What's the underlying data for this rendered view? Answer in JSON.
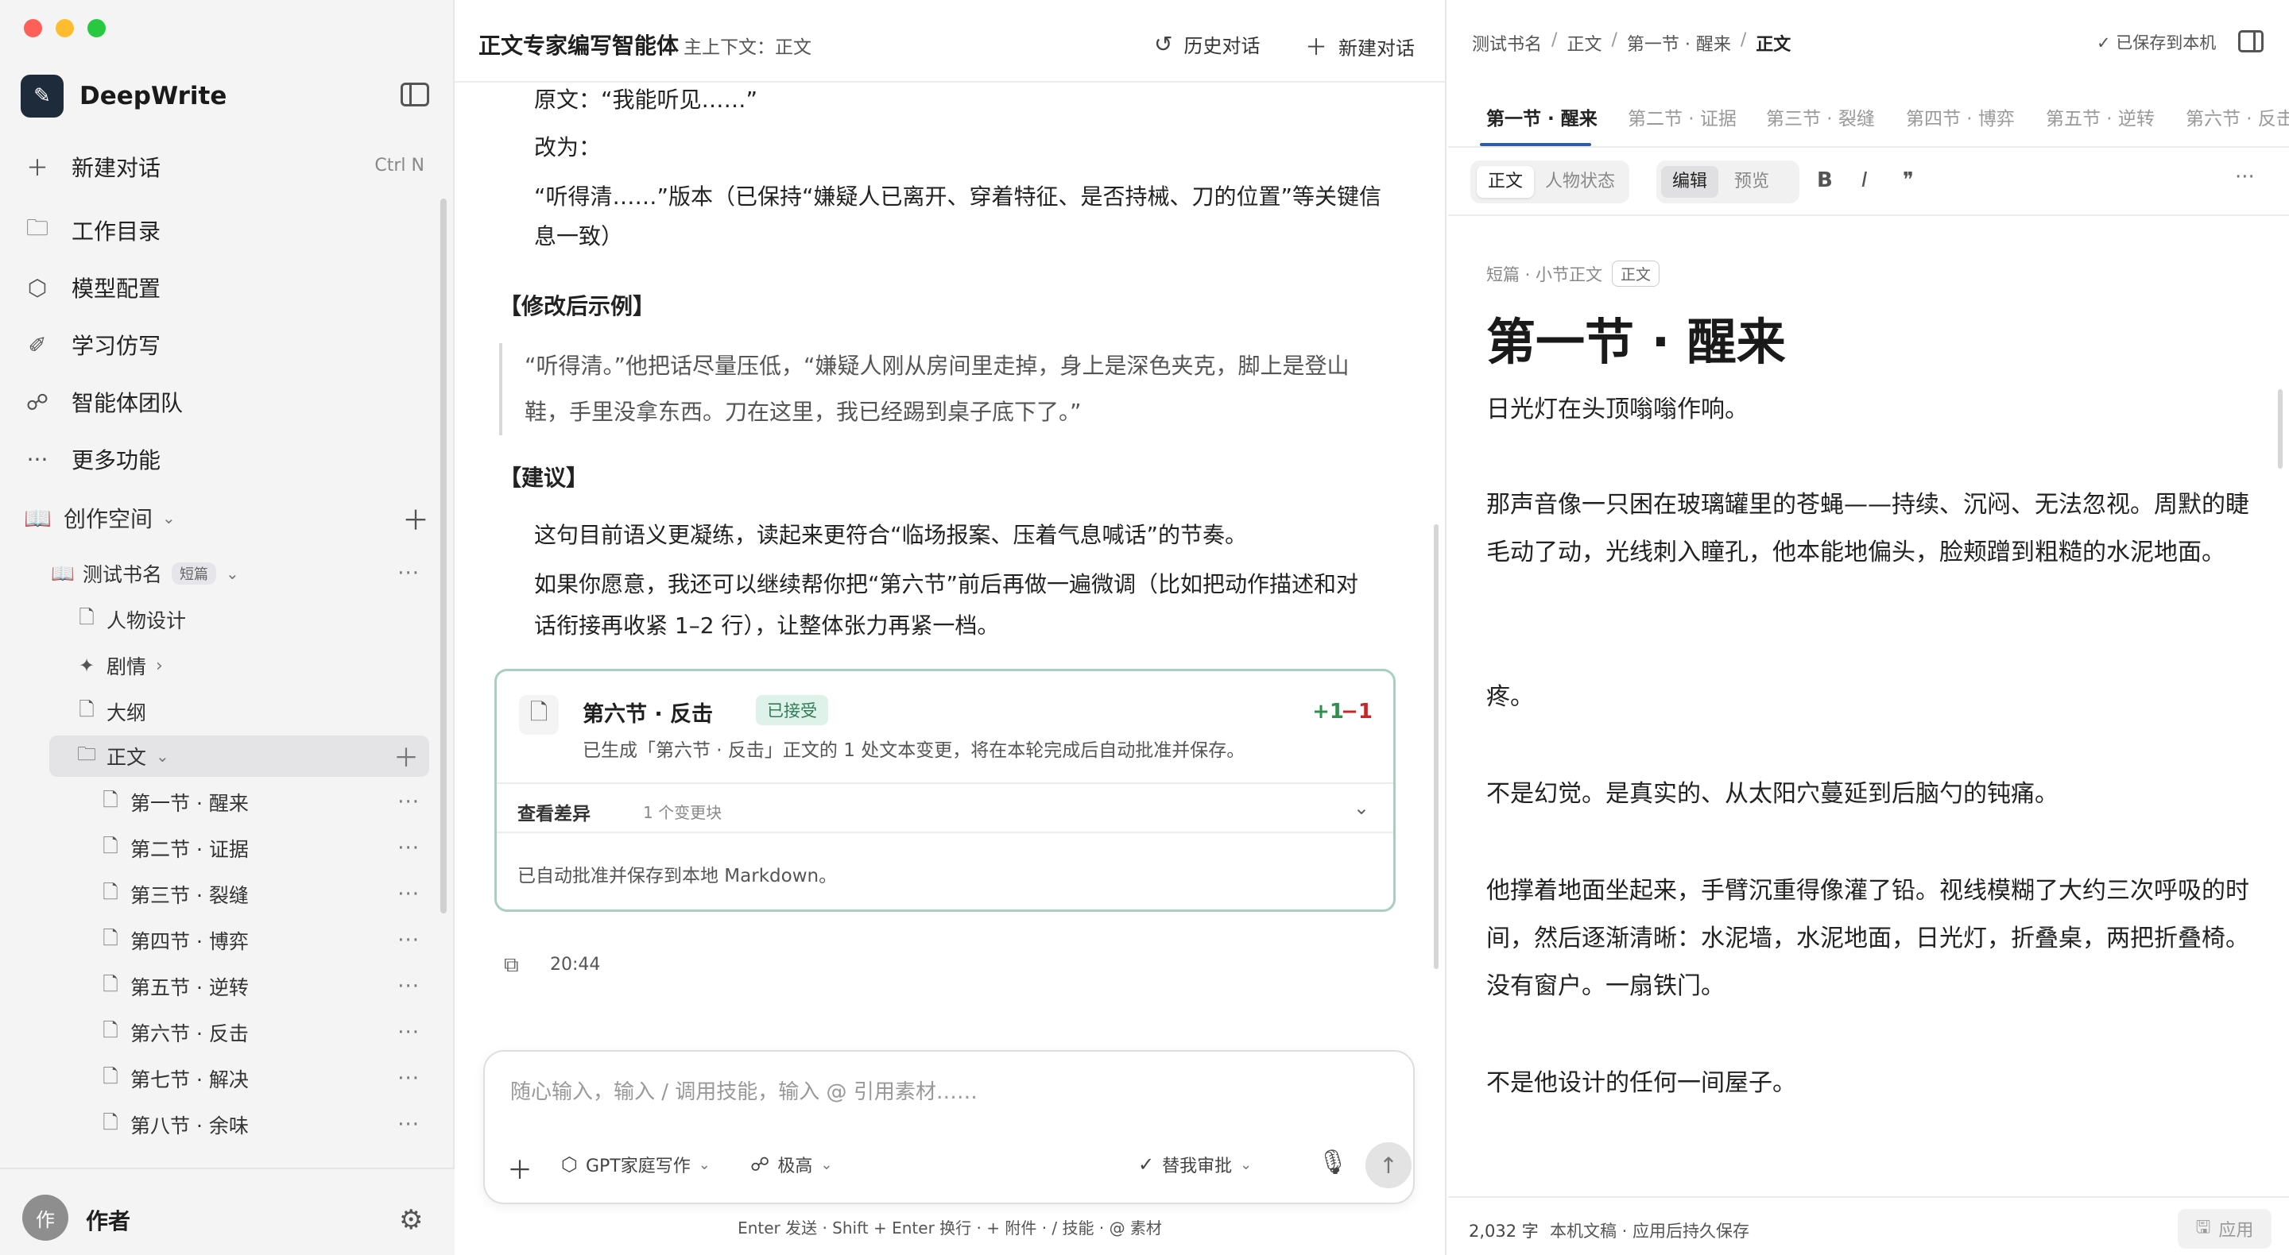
{
  "app": {
    "name": "DeepWrite"
  },
  "sidebar": {
    "new_chat": {
      "label": "新建对话",
      "shortcut": "Ctrl N"
    },
    "nav": [
      {
        "label": "工作目录",
        "icon": "folder-icon"
      },
      {
        "label": "模型配置",
        "icon": "cube-icon"
      },
      {
        "label": "学习仿写",
        "icon": "pen-icon"
      },
      {
        "label": "智能体团队",
        "icon": "brain-icon"
      },
      {
        "label": "更多功能",
        "icon": "more-icon"
      }
    ],
    "space": {
      "label": "创作空间"
    },
    "tree": {
      "book": {
        "label": "测试书名",
        "tag": "短篇"
      },
      "items": [
        {
          "label": "人物设计"
        },
        {
          "label": "剧情"
        },
        {
          "label": "大纲"
        }
      ],
      "folder": {
        "label": "正文"
      },
      "chapters": [
        "第一节 · 醒来",
        "第二节 · 证据",
        "第三节 · 裂缝",
        "第四节 · 博弈",
        "第五节 · 逆转",
        "第六节 · 反击",
        "第七节 · 解决",
        "第八节 · 余味"
      ]
    },
    "user": {
      "avatar": "作",
      "name": "作者"
    }
  },
  "chat": {
    "title": "正文专家编写智能体",
    "context": "主上下文：正文",
    "history_label": "历史对话",
    "new_label": "新建对话",
    "lines": {
      "orig": "原文：“我能听见……”",
      "change_to": "改为：",
      "revised_1": "“听得清……”版本（已保持“嫌疑人已离开、穿着特征、是否持械、刀的位置”等关键信",
      "revised_2": "息一致）",
      "example_head": "【修改后示例】",
      "example_quote_1": "“听得清。”他把话尽量压低，“嫌疑人刚从房间里走掉，身上是深色夹克，脚上是登山",
      "example_quote_2": "鞋，手里没拿东西。刀在这里，我已经踢到桌子底下了。”",
      "suggest_head": "【建议】",
      "suggest_1": "这句目前语义更凝练，读起来更符合“临场报案、压着气息喊话”的节奏。",
      "suggest_2": "如果你愿意，我还可以继续帮你把“第六节”前后再做一遍微调（比如把动作描述和对",
      "suggest_3": "话衔接再收紧 1–2 行），让整体张力再紧一档。"
    },
    "change_card": {
      "title": "第六节 · 反击",
      "badge": "已接受",
      "plus": "+1",
      "minus": "−1",
      "desc": "已生成「第六节 · 反击」正文的 1 处文本变更，将在本轮完成后自动批准并保存。",
      "diff_label": "查看差异",
      "diff_count": "1 个变更块",
      "note": "已自动批准并保存到本地 Markdown。"
    },
    "time": "20:44",
    "composer": {
      "placeholder": "随心输入，输入 / 调用技能，输入 @ 引用素材……",
      "model": "GPT家庭写作",
      "effort": "极高",
      "approval": "替我审批"
    },
    "hint": "Enter 发送 · Shift + Enter 换行 · + 附件 · / 技能 · @ 素材"
  },
  "editor": {
    "breadcrumb": [
      "测试书名",
      "正文",
      "第一节 · 醒来",
      "正文"
    ],
    "saved": "已保存到本机",
    "tabs": [
      "第一节 · 醒来",
      "第二节 · 证据",
      "第三节 · 裂缝",
      "第四节 · 博弈",
      "第五节 · 逆转",
      "第六节 · 反击"
    ],
    "view_tabs": [
      "正文",
      "人物状态"
    ],
    "mode_tabs": [
      "编辑",
      "预览"
    ],
    "meta": "短篇 · 小节正文",
    "meta_tag": "正文",
    "doc_title": "第一节 · 醒来",
    "paragraphs": [
      "日光灯在头顶嗡嗡作响。",
      "那声音像一只困在玻璃罐里的苍蝇——持续、沉闷、无法忽视。周默的睫毛动了动，光线刺入瞳孔，他本能地偏头，脸颊蹭到粗糙的水泥地面。",
      "疼。",
      "不是幻觉。是真实的、从太阳穴蔓延到后脑勺的钝痛。",
      "他撑着地面坐起来，手臂沉重得像灌了铅。视线模糊了大约三次呼吸的时间，然后逐渐清晰：水泥墙，水泥地面，日光灯，折叠桌，两把折叠椅。没有窗户。一扇铁门。",
      "不是他设计的任何一间屋子。"
    ],
    "word_count": "2,032 字",
    "status_note": "本机文稿 · 应用后持久保存",
    "apply": "应用"
  }
}
